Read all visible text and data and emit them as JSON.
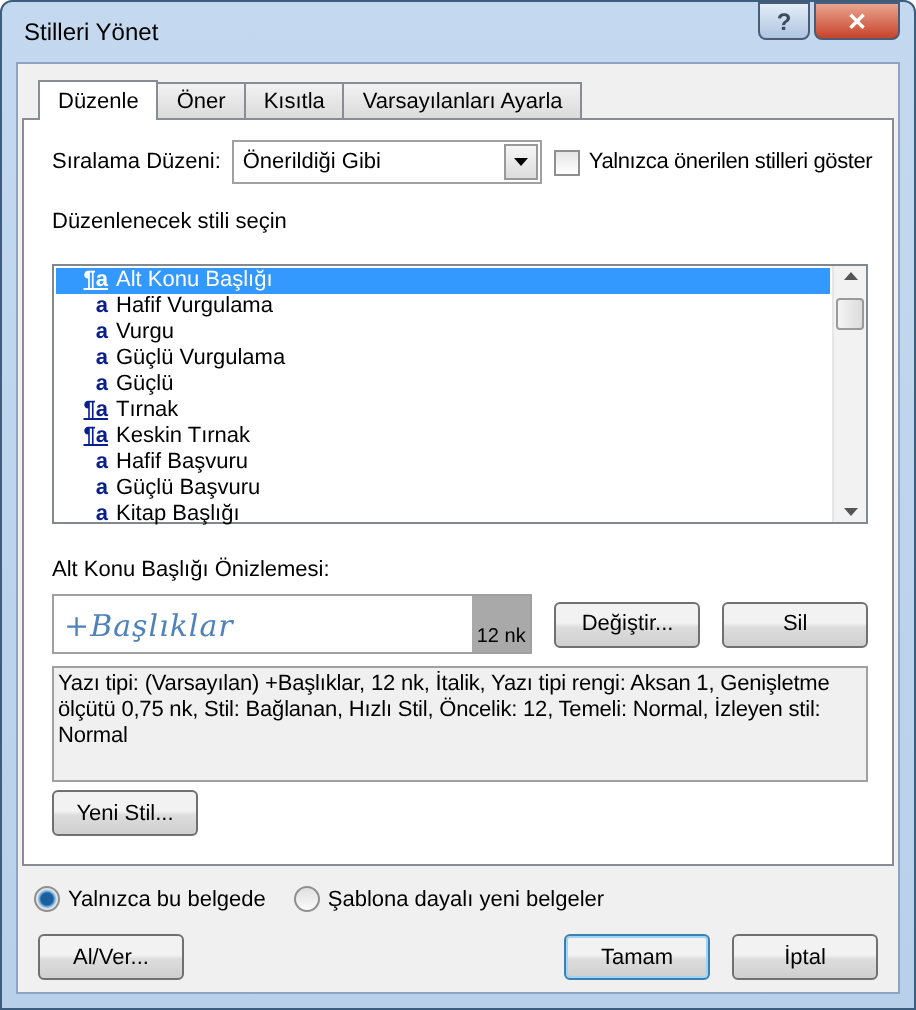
{
  "window": {
    "title": "Stilleri Yönet",
    "help": "?",
    "close": "✕"
  },
  "tabs": [
    {
      "label": "Düzenle",
      "selected": true
    },
    {
      "label": "Öner",
      "selected": false
    },
    {
      "label": "Kısıtla",
      "selected": false
    },
    {
      "label": "Varsayılanları Ayarla",
      "selected": false
    }
  ],
  "sort": {
    "label": "Sıralama Düzeni:",
    "value": "Önerildiği Gibi"
  },
  "only_recommended": {
    "label": "Yalnızca önerilen stilleri göster",
    "checked": false
  },
  "list_label": "Düzenlenecek stili seçin",
  "styles": [
    {
      "icon": "¶a",
      "name": "Alt Konu Başlığı",
      "kind": "paragraph",
      "selected": true
    },
    {
      "icon": "a",
      "name": "Hafif Vurgulama",
      "kind": "character",
      "selected": false
    },
    {
      "icon": "a",
      "name": "Vurgu",
      "kind": "character",
      "selected": false
    },
    {
      "icon": "a",
      "name": "Güçlü Vurgulama",
      "kind": "character",
      "selected": false
    },
    {
      "icon": "a",
      "name": "Güçlü",
      "kind": "character",
      "selected": false
    },
    {
      "icon": "¶a",
      "name": "Tırnak",
      "kind": "paragraph",
      "selected": false
    },
    {
      "icon": "¶a",
      "name": "Keskin Tırnak",
      "kind": "paragraph",
      "selected": false
    },
    {
      "icon": "a",
      "name": "Hafif Başvuru",
      "kind": "character",
      "selected": false
    },
    {
      "icon": "a",
      "name": "Güçlü Başvuru",
      "kind": "character",
      "selected": false
    },
    {
      "icon": "a",
      "name": "Kitap Başlığı",
      "kind": "character",
      "selected": false
    }
  ],
  "preview": {
    "label": "Alt Konu Başlığı Önizlemesi:",
    "sample": "+Başlıklar",
    "size": "12 nk"
  },
  "buttons_preview": [
    "Değiştir...",
    "Sil"
  ],
  "description": "Yazı tipi: (Varsayılan) +Başlıklar, 12 nk, İtalik, Yazı tipi rengi: Aksan 1, Genişletme ölçütü  0,75 nk, Stil: Bağlanan, Hızlı Stil, Öncelik: 12, Temeli: Normal, İzleyen stil: Normal",
  "new_style": "Yeni Stil...",
  "scope": [
    {
      "label": "Yalnızca bu belgede",
      "selected": true
    },
    {
      "label": "Şablona dayalı yeni belgeler",
      "selected": false
    }
  ],
  "footer": {
    "import_export": "Al/Ver...",
    "ok": "Tamam",
    "cancel": "İptal"
  }
}
